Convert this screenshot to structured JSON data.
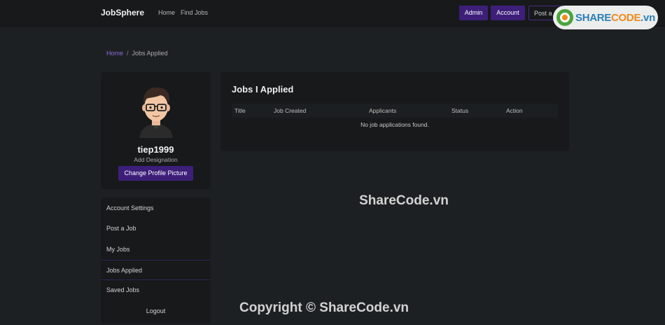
{
  "nav": {
    "brand": "JobSphere",
    "links": [
      "Home",
      "Find Jobs"
    ],
    "admin_label": "Admin",
    "account_label": "Account",
    "post_label": "Post a"
  },
  "watermark": {
    "logo_text_main": "SHARE",
    "logo_text_accent": "CODE",
    "logo_text_suffix": ".vn",
    "center_text": "ShareCode.vn",
    "bottom_text": "Copyright © ShareCode.vn"
  },
  "breadcrumb": {
    "home": "Home",
    "separator": "/",
    "current": "Jobs Applied"
  },
  "profile": {
    "username": "tiep1999",
    "designation": "Add Designation",
    "change_picture_label": "Change Profile Picture"
  },
  "sidebar": {
    "items": [
      {
        "label": "Account Settings"
      },
      {
        "label": "Post a Job"
      },
      {
        "label": "My Jobs"
      },
      {
        "label": "Jobs Applied"
      },
      {
        "label": "Saved Jobs"
      },
      {
        "label": "Logout"
      }
    ]
  },
  "jobs": {
    "title": "Jobs I Applied",
    "columns": [
      "Title",
      "Job Created",
      "Applicants",
      "Status",
      "Action"
    ],
    "empty_message": "No job applications found."
  },
  "colors": {
    "accent": "#3d1f7a",
    "background": "#1d2022",
    "card": "#17191b",
    "link": "#8d6de0"
  }
}
